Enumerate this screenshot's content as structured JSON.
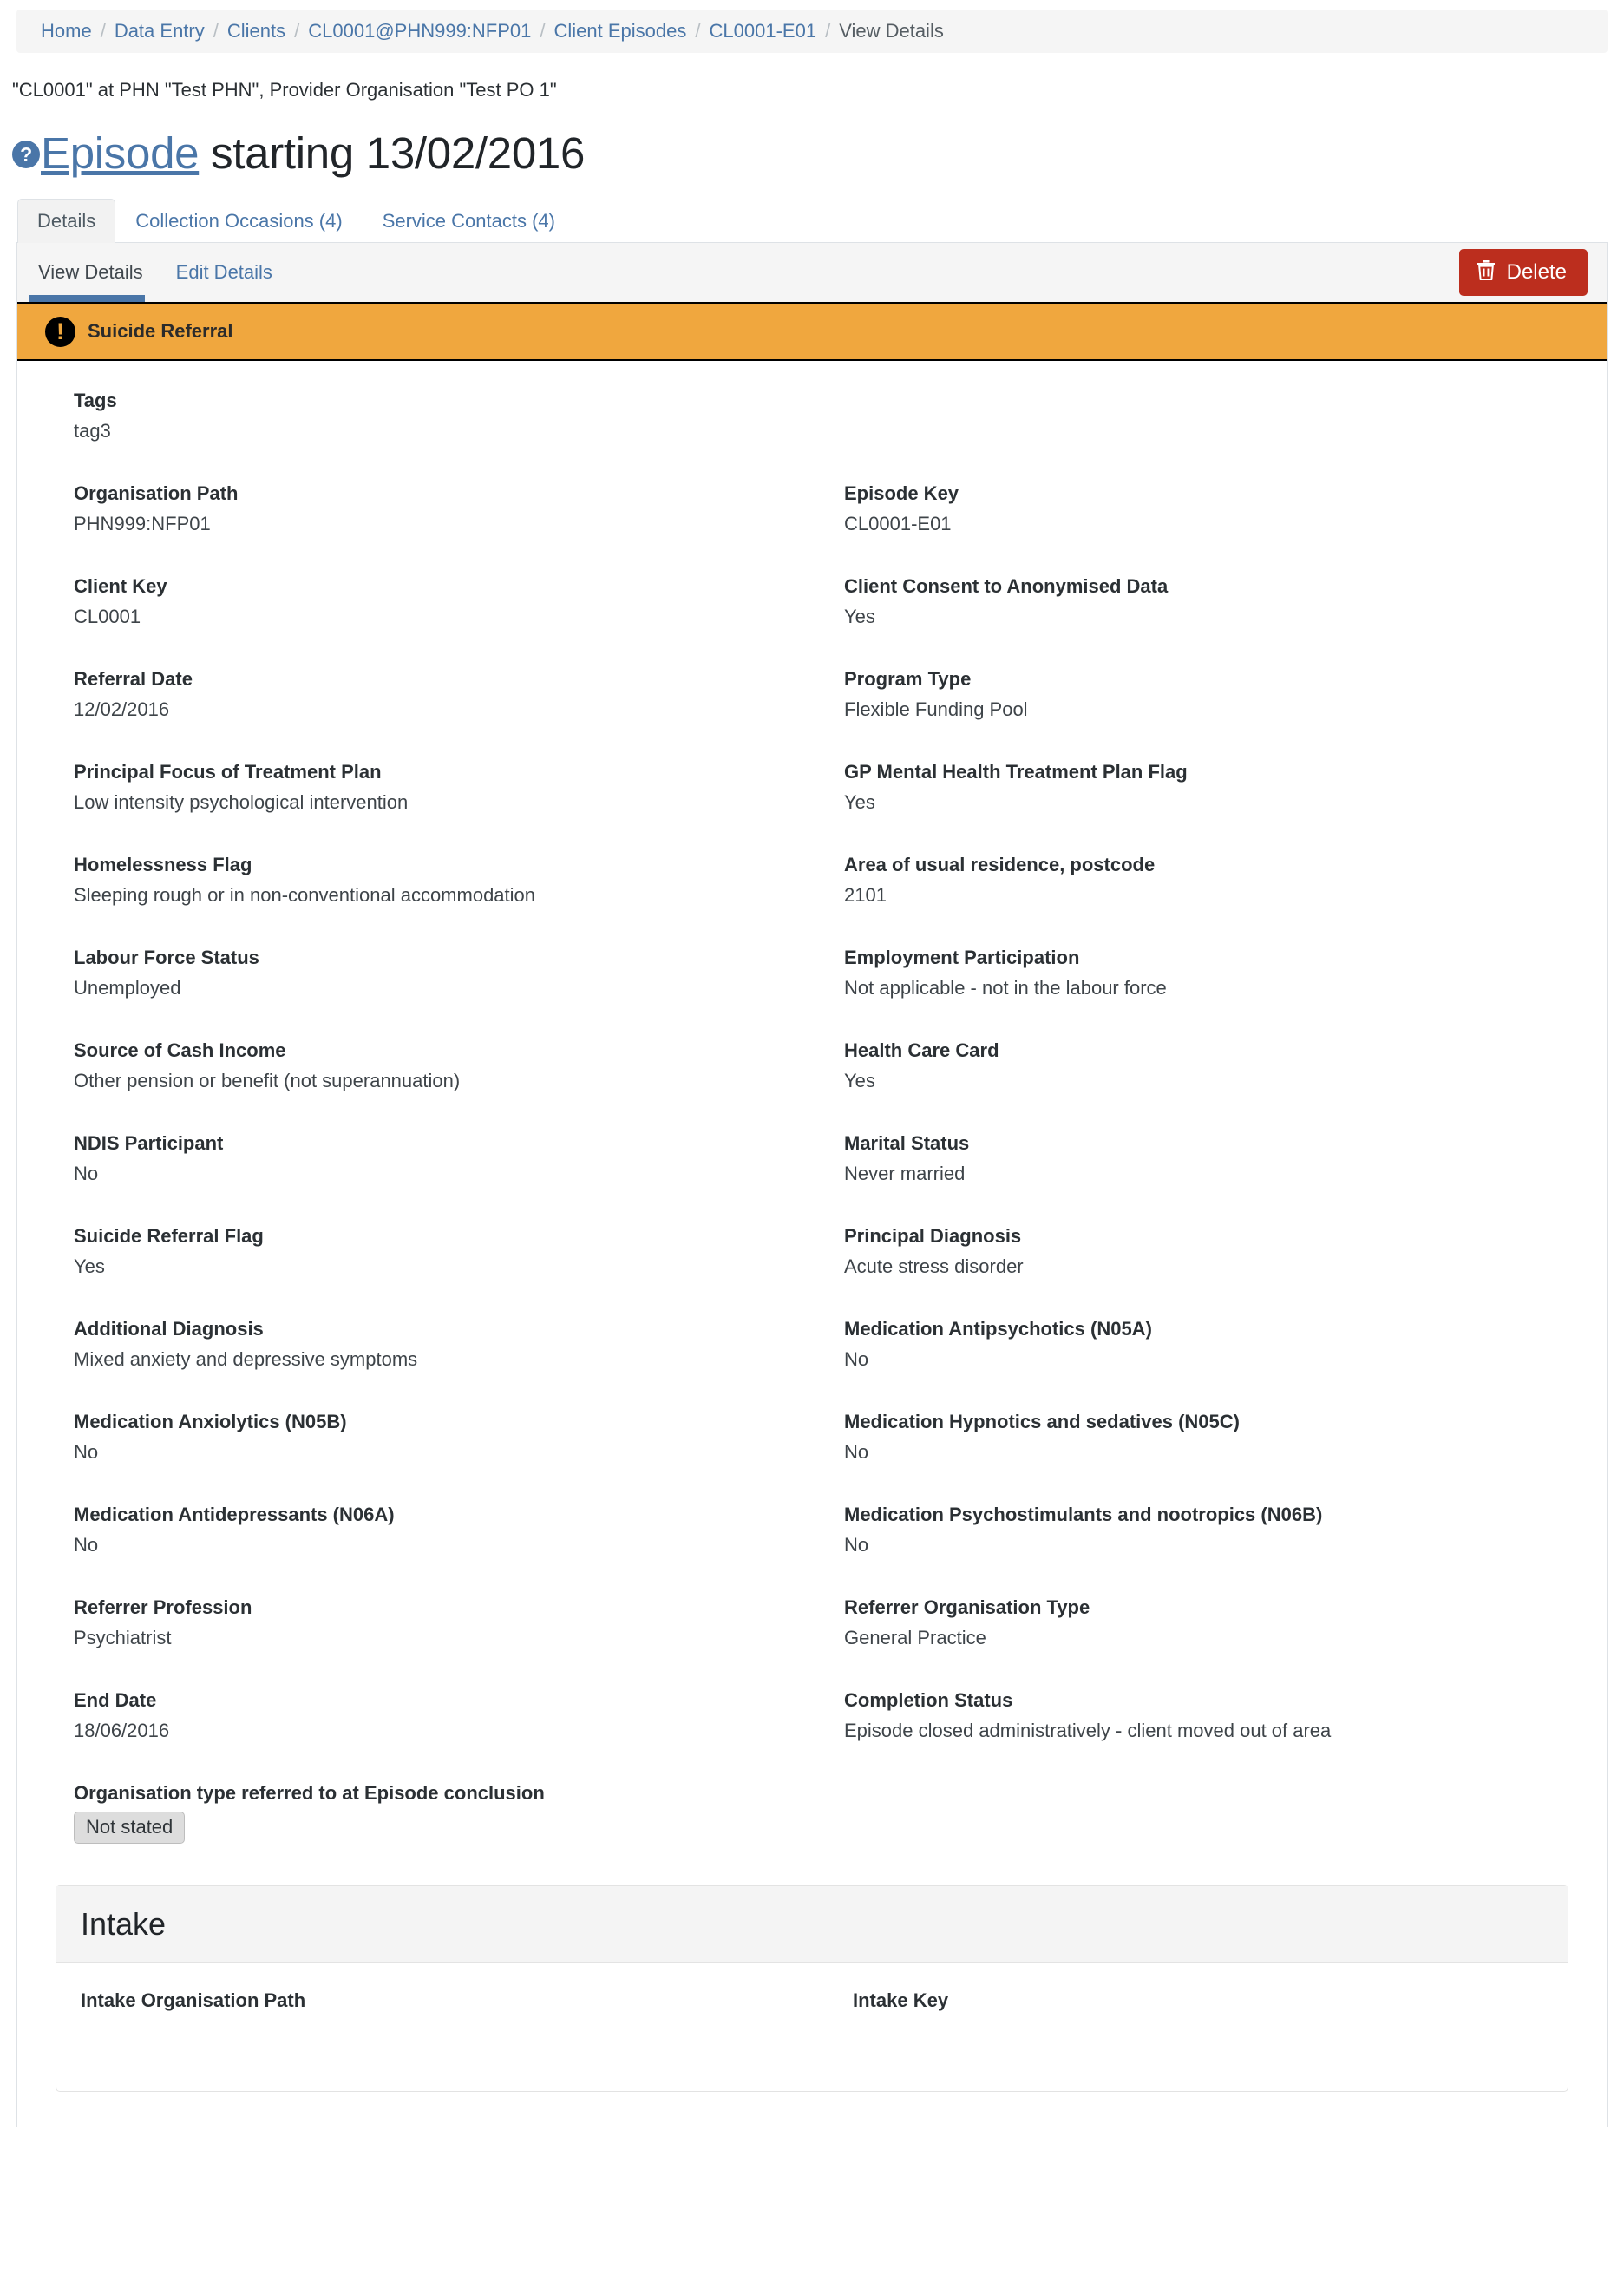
{
  "breadcrumb": {
    "items": [
      {
        "label": "Home",
        "link": true
      },
      {
        "label": "Data Entry",
        "link": true
      },
      {
        "label": "Clients",
        "link": true
      },
      {
        "label": "CL0001@PHN999:NFP01",
        "link": true
      },
      {
        "label": "Client Episodes",
        "link": true
      },
      {
        "label": "CL0001-E01",
        "link": true
      },
      {
        "label": "View Details",
        "link": false
      }
    ],
    "separator": "/"
  },
  "subtitle": "\"CL0001\" at PHN \"Test PHN\", Provider Organisation \"Test PO 1\"",
  "title": {
    "help_icon_glyph": "?",
    "link_text": "Episode",
    "rest_text": " starting 13/02/2016"
  },
  "tabs": [
    {
      "label": "Details",
      "active": true
    },
    {
      "label": "Collection Occasions (4)",
      "active": false
    },
    {
      "label": "Service Contacts (4)",
      "active": false
    }
  ],
  "subnav": [
    {
      "label": "View Details",
      "active": true
    },
    {
      "label": "Edit Details",
      "active": false
    }
  ],
  "toolbar": {
    "delete_label": "Delete",
    "delete_color": "#bc2e1e"
  },
  "alert": {
    "text": "Suicide Referral",
    "icon_glyph": "!",
    "background_color": "#f0a73e"
  },
  "details": {
    "tags": {
      "label": "Tags",
      "value": "tag3"
    },
    "fields": [
      {
        "label": "Organisation Path",
        "value": "PHN999:NFP01"
      },
      {
        "label": "Episode Key",
        "value": "CL0001-E01"
      },
      {
        "label": "Client Key",
        "value": "CL0001"
      },
      {
        "label": "Client Consent to Anonymised Data",
        "value": "Yes"
      },
      {
        "label": "Referral Date",
        "value": "12/02/2016"
      },
      {
        "label": "Program Type",
        "value": "Flexible Funding Pool"
      },
      {
        "label": "Principal Focus of Treatment Plan",
        "value": "Low intensity psychological intervention"
      },
      {
        "label": "GP Mental Health Treatment Plan Flag",
        "value": "Yes"
      },
      {
        "label": "Homelessness Flag",
        "value": "Sleeping rough or in non-conventional accommodation"
      },
      {
        "label": "Area of usual residence, postcode",
        "value": "2101"
      },
      {
        "label": "Labour Force Status",
        "value": "Unemployed"
      },
      {
        "label": "Employment Participation",
        "value": "Not applicable - not in the labour force"
      },
      {
        "label": "Source of Cash Income",
        "value": "Other pension or benefit (not superannuation)"
      },
      {
        "label": "Health Care Card",
        "value": "Yes"
      },
      {
        "label": "NDIS Participant",
        "value": "No"
      },
      {
        "label": "Marital Status",
        "value": "Never married"
      },
      {
        "label": "Suicide Referral Flag",
        "value": "Yes"
      },
      {
        "label": "Principal Diagnosis",
        "value": "Acute stress disorder"
      },
      {
        "label": "Additional Diagnosis",
        "value": "Mixed anxiety and depressive symptoms"
      },
      {
        "label": "Medication Antipsychotics (N05A)",
        "value": "No"
      },
      {
        "label": "Medication Anxiolytics (N05B)",
        "value": "No"
      },
      {
        "label": "Medication Hypnotics and sedatives (N05C)",
        "value": "No"
      },
      {
        "label": "Medication Antidepressants (N06A)",
        "value": "No"
      },
      {
        "label": "Medication Psychostimulants and nootropics (N06B)",
        "value": "No"
      },
      {
        "label": "Referrer Profession",
        "value": "Psychiatrist"
      },
      {
        "label": "Referrer Organisation Type",
        "value": "General Practice"
      },
      {
        "label": "End Date",
        "value": "18/06/2016"
      },
      {
        "label": "Completion Status",
        "value": "Episode closed administratively - client moved out of area"
      }
    ],
    "conclusion": {
      "label": "Organisation type referred to at Episode conclusion",
      "badge": "Not stated"
    }
  },
  "intake": {
    "title": "Intake",
    "fields": [
      {
        "label": "Intake Organisation Path",
        "value": ""
      },
      {
        "label": "Intake Key",
        "value": ""
      }
    ]
  }
}
